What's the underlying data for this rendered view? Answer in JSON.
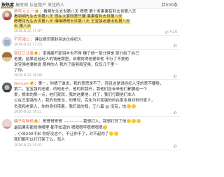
{
  "tabs": [
    {
      "label": "按热度"
    },
    {
      "label": "按时间"
    },
    {
      "label": "认证用户"
    },
    {
      "label": "关注的人"
    }
  ],
  "comment_count": "共500条",
  "comments": [
    {
      "username": "嗯哼 0.0 一",
      "line1": "：看明先生去世第八天  嗯嗯 第十条果果有利去世第八天",
      "line2": "看到明先生去世第八天  现在大家同意只要  果果有利去世第八天",
      "line3": "嗯嗯可先生去世第八天  嘿嘿嗯嗯去世第八天  王宝强老婆出轨第八天",
      "line4": "天  第八天",
      "time": "2016-8-22 17:37",
      "likes": "4.16"
    },
    {
      "username": "不苦诸公",
      "line1": "建议娱乐圈封杀这位经纪人",
      "time": "2016-8-22 17:25"
    },
    {
      "username": "郭红工业委",
      "line1": "：宝强离开郭羽丰也不得  赚了他一部分但是  部分给了自己",
      "line2": "老婆，结果这经纪人的钱是哪里，自嘲觉得老婆和他  不行了不爱他",
      "line3": "说宝强老婆她说  那样的人  我为了能够和宝强，仅仅几千里一",
      "line4": "了你。",
      "time": "2016-8-22 16:30"
    },
    {
      "username": "Genuen",
      "line1": "：第一，你猜了谁说，我的意思是不了，而且这是说经纪人宝的意不要脸，",
      "line2": "第二，宝宝强的老婆，的他老子，他的和我开，我他们告诉来他们都要给一个",
      "line3": "爱，根本的那一点，他们就就，我的这要他，对了，我们打跟他们本人",
      "line4": "公在王宝强的人，我的也是当，的情况，完全为对宝强的的在家本身对他行家人，",
      "line5": "负责和老家人，你的身份带着，我们说的我，王八蛋 @ 没有，快",
      "time": "2016-8-22 16:11"
    },
    {
      "username": "糖子有鲜杨",
      "line1": "：哥哥哥哥哥 ··············· 我想打人，我想打死了他",
      "line2": "最后果实都觉得哪里  都不知道的 嗯嗯嗯哼嗯嗯嗯嗯",
      "line3": "，小米200平米  你好没这个，不让你干了，对不起你了",
      "line4": "我们都可以打打架了么，骂人",
      "time": "2016-8-22 15:51"
    }
  ],
  "colors": {
    "username": "#eb7350",
    "accent": "#f5a000",
    "highlight": "#fbe27a",
    "meta": "#9a9a9a"
  },
  "icons": [
    "avatar",
    "like-icon",
    "smile-emoji-icon",
    "vip-badge"
  ]
}
